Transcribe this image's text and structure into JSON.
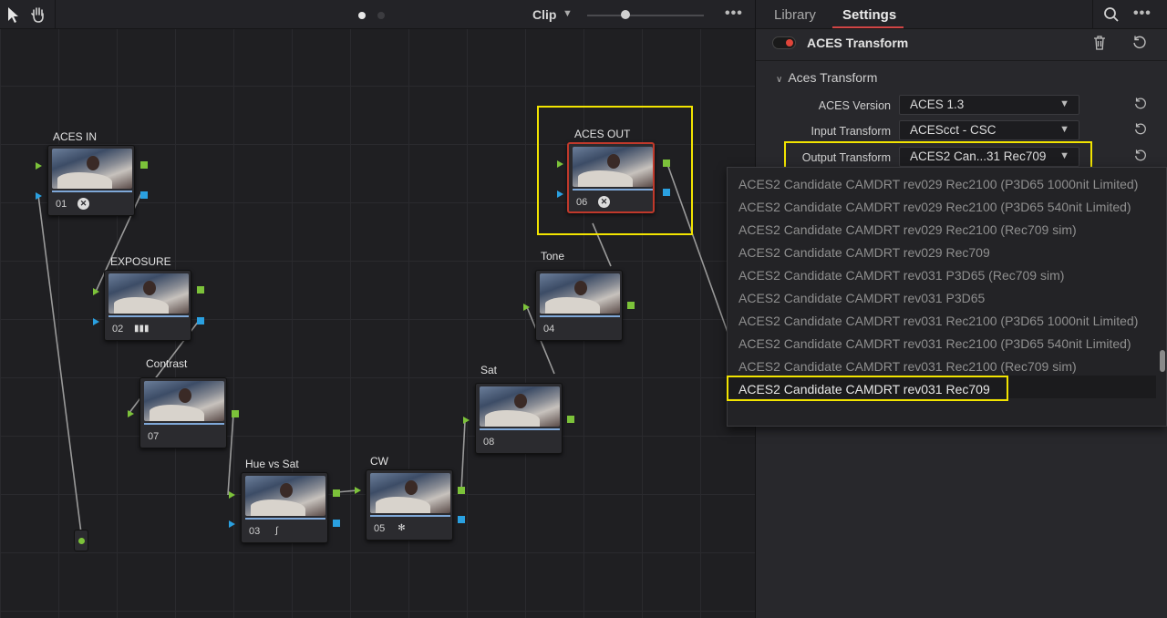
{
  "toolbar": {
    "pointer_icon": "pointer-icon",
    "hand_icon": "hand-icon",
    "view_label": "Clip",
    "more_label": "•••"
  },
  "nodes": [
    {
      "label": "ACES IN",
      "number": "01",
      "icon": "aces-icon"
    },
    {
      "label": "EXPOSURE",
      "number": "02",
      "icon": "bars-icon"
    },
    {
      "label": "Contrast",
      "number": "07",
      "icon": ""
    },
    {
      "label": "Hue vs Sat",
      "number": "03",
      "icon": "curve-icon"
    },
    {
      "label": "CW",
      "number": "05",
      "icon": "wheels-icon"
    },
    {
      "label": "Sat",
      "number": "08",
      "icon": ""
    },
    {
      "label": "Tone",
      "number": "04",
      "icon": ""
    },
    {
      "label": "ACES OUT",
      "number": "06",
      "icon": "aces-icon"
    }
  ],
  "panel": {
    "tabs": [
      "Library",
      "Settings"
    ],
    "active_tab": "Settings",
    "more_label": "•••",
    "effect_title": "ACES Transform",
    "section_title": "Aces Transform",
    "params": [
      {
        "label": "ACES Version",
        "value": "ACES 1.3"
      },
      {
        "label": "Input Transform",
        "value": "ACEScct - CSC"
      },
      {
        "label": "Output Transform",
        "value": "ACES2 Can...31 Rec709"
      }
    ],
    "dropdown_options": [
      "ACES2 Candidate CAMDRT rev029 Rec2100 (P3D65 1000nit Limited)",
      "ACES2 Candidate CAMDRT rev029 Rec2100 (P3D65 540nit Limited)",
      "ACES2 Candidate CAMDRT rev029 Rec2100 (Rec709 sim)",
      "ACES2 Candidate CAMDRT rev029 Rec709",
      "ACES2 Candidate CAMDRT rev031 P3D65 (Rec709 sim)",
      "ACES2 Candidate CAMDRT rev031 P3D65",
      "ACES2 Candidate CAMDRT rev031 Rec2100 (P3D65 1000nit Limited)",
      "ACES2 Candidate CAMDRT rev031 Rec2100 (P3D65 540nit Limited)",
      "ACES2 Candidate CAMDRT rev031 Rec2100 (Rec709 sim)",
      "ACES2 Candidate CAMDRT rev031 Rec709"
    ],
    "selected_option": "ACES2 Candidate CAMDRT rev031 Rec709"
  },
  "colors": {
    "highlight": "#f2e400",
    "accent_red": "#d04545",
    "pin_green": "#7cc23a",
    "pin_blue": "#2aa0e0"
  }
}
